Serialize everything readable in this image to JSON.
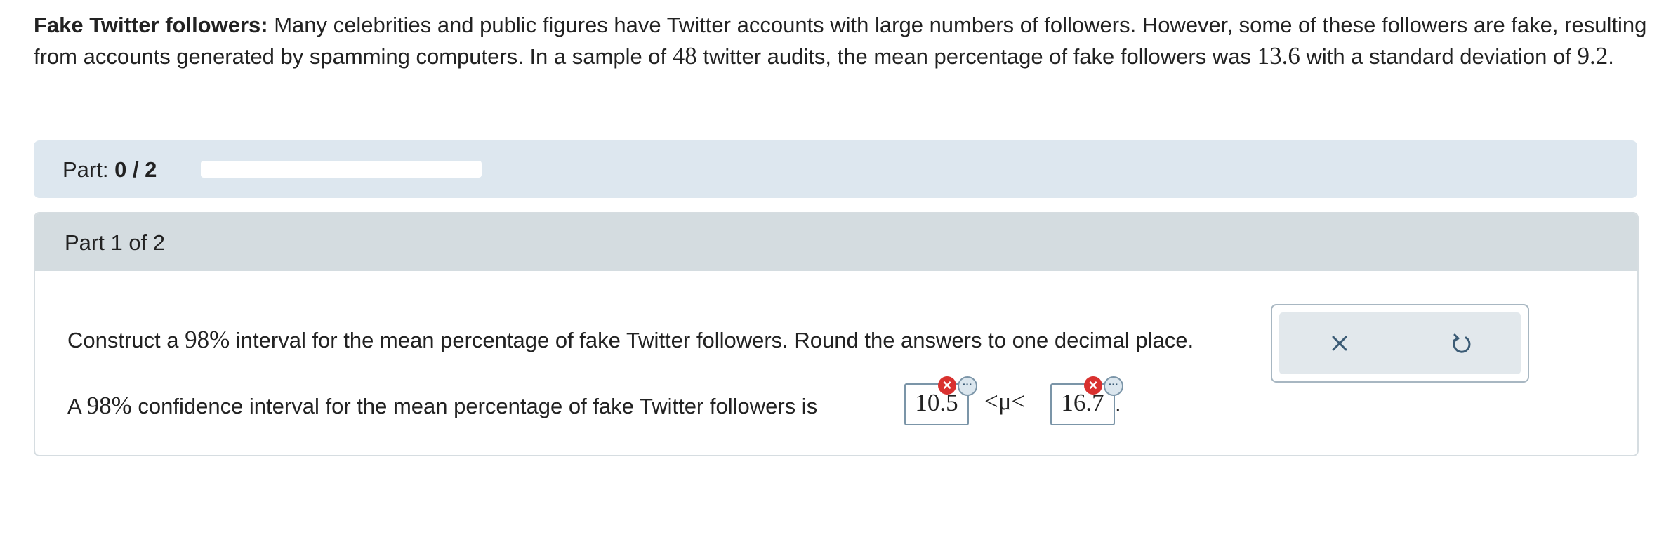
{
  "problem": {
    "title": "Fake Twitter followers:",
    "text_1": " Many celebrities and public figures have Twitter accounts with large numbers of followers. However, some of these followers are fake, resulting from accounts generated by spamming computers. In a sample of ",
    "sample_size": "48",
    "text_2": " twitter audits, the mean percentage of fake followers was ",
    "mean": "13.6",
    "text_3": " with a standard deviation of ",
    "std_dev": "9.2",
    "text_4": "."
  },
  "progress": {
    "label": "Part:",
    "value": "0 / 2",
    "fraction": 0
  },
  "part": {
    "header": "Part 1 of 2",
    "question_1": "Construct a ",
    "confidence": "98%",
    "question_2": " interval for the mean percentage of fake Twitter followers. Round the answers to one decimal place.",
    "answer_1": "A ",
    "answer_2": " confidence interval for the mean percentage of fake Twitter followers is",
    "lower_value": "10.5",
    "upper_value": "16.7",
    "relation": "<μ<",
    "period": "."
  },
  "icons": {
    "incorrect": "incorrect-x-icon",
    "more": "more-options-icon",
    "clear": "close-icon",
    "undo": "undo-icon"
  },
  "colors": {
    "accent": "#3b7cb5",
    "error": "#d9312f",
    "progress_bg": "#dde7ef",
    "part_header_bg": "#d4dce0"
  }
}
